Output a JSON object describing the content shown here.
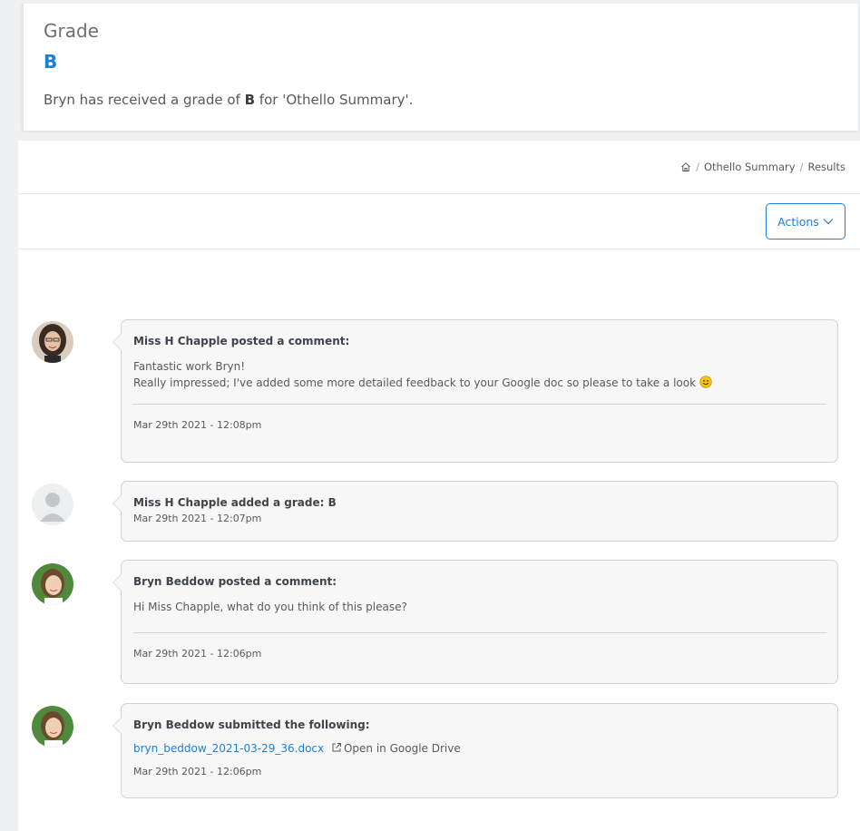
{
  "grade_card": {
    "heading": "Grade",
    "grade": "B",
    "message_prefix": "Bryn has received a grade of ",
    "message_grade": "B",
    "message_suffix": " for 'Othello Summary'."
  },
  "breadcrumb": {
    "home_icon": "home-icon",
    "items": [
      "Othello Summary",
      "Results"
    ]
  },
  "actions": {
    "label": "Actions"
  },
  "timeline": [
    {
      "author": "Miss H Chapple",
      "title": "Miss H Chapple posted a comment:",
      "body_line1": "Fantastic work Bryn!",
      "body_line2": "Really impressed; I've added some more detailed feedback to your Google doc so please to take a look",
      "emoji": "smile-emoji",
      "date": "Mar 29th 2021 - 12:08pm"
    },
    {
      "author": "Miss H Chapple",
      "title": "Miss H Chapple added a grade: B",
      "date": "Mar 29th 2021 - 12:07pm"
    },
    {
      "author": "Bryn Beddow",
      "title": "Bryn Beddow posted a comment:",
      "body_line1": "Hi Miss Chapple, what do you think of this please?",
      "date": "Mar 29th 2021 - 12:06pm"
    },
    {
      "author": "Bryn Beddow",
      "title": "Bryn Beddow submitted the following:",
      "file_name": "bryn_beddow_2021-03-29_36.docx",
      "drive_label": "Open in Google Drive",
      "date": "Mar 29th 2021 - 12:06pm"
    }
  ],
  "colors": {
    "accent": "#1e7fd1",
    "bubble_bg": "#f7f7f8",
    "border": "#d0d3d6"
  }
}
